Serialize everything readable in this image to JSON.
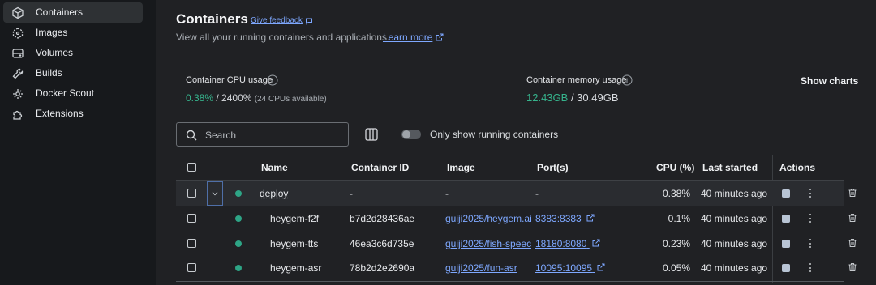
{
  "sidebar": {
    "items": [
      {
        "label": "Containers",
        "icon": "container-cube-icon",
        "active": true
      },
      {
        "label": "Images",
        "icon": "images-icon"
      },
      {
        "label": "Volumes",
        "icon": "volumes-icon"
      },
      {
        "label": "Builds",
        "icon": "builds-wrench-icon"
      },
      {
        "label": "Docker Scout",
        "icon": "scout-icon"
      },
      {
        "label": "Extensions",
        "icon": "extensions-puzzle-icon"
      }
    ]
  },
  "header": {
    "title": "Containers",
    "feedback_label": "Give feedback",
    "subtitle": "View all your running containers and applications.",
    "learn_more": "Learn more"
  },
  "stats": {
    "cpu_title": "Container CPU usage",
    "cpu_used": "0.38%",
    "cpu_total": "/ 2400%",
    "cpu_note": "(24 CPUs available)",
    "mem_title": "Container memory usage",
    "mem_used": "12.43GB",
    "mem_total": "/ 30.49GB",
    "show_charts": "Show charts"
  },
  "toolbar": {
    "search_placeholder": "Search",
    "only_running_label": "Only show running containers"
  },
  "table": {
    "headers": {
      "name": "Name",
      "container_id": "Container ID",
      "image": "Image",
      "ports": "Port(s)",
      "cpu": "CPU (%)",
      "last_started": "Last started",
      "actions": "Actions"
    },
    "rows": [
      {
        "name": "deploy",
        "container_id": "-",
        "image": "-",
        "ports": "-",
        "cpu": "0.38%",
        "last_started": "40 minutes ago"
      },
      {
        "name": "heygem-f2f",
        "container_id": "b7d2d28436ae",
        "image": "guiji2025/heygem.ai",
        "ports": "8383:8383",
        "cpu": "0.1%",
        "last_started": "40 minutes ago"
      },
      {
        "name": "heygem-tts",
        "container_id": "46ea3c6d735e",
        "image": "guiji2025/fish-speec",
        "ports": "18180:8080",
        "cpu": "0.23%",
        "last_started": "40 minutes ago"
      },
      {
        "name": "heygem-asr",
        "container_id": "78b2d2e2690a",
        "image": "guiji2025/fun-asr",
        "ports": "10095:10095",
        "cpu": "0.05%",
        "last_started": "40 minutes ago"
      }
    ]
  },
  "colors": {
    "accent_link": "#7ea8ff",
    "running_green": "#2ea586",
    "stat_green": "#36b38c"
  }
}
